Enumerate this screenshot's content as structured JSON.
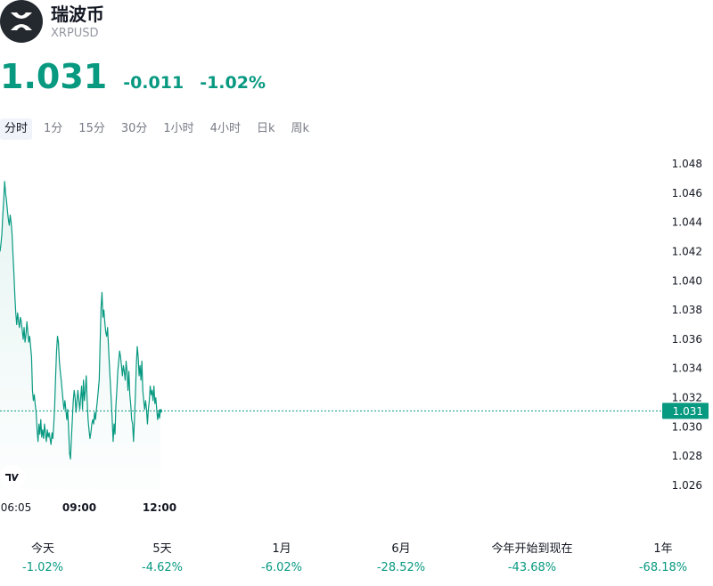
{
  "header": {
    "title": "瑞波币",
    "symbol": "XRPUSD"
  },
  "quote": {
    "price": "1.031",
    "change": "-0.011",
    "change_pct": "-1.02%",
    "color": "#089981"
  },
  "tabs": [
    {
      "label": "分时",
      "active": true
    },
    {
      "label": "1分"
    },
    {
      "label": "15分"
    },
    {
      "label": "30分"
    },
    {
      "label": "1小时"
    },
    {
      "label": "4小时"
    },
    {
      "label": "日k"
    },
    {
      "label": "周k"
    }
  ],
  "chart_data": {
    "type": "area",
    "y_ticks": [
      "1.048",
      "1.046",
      "1.044",
      "1.042",
      "1.040",
      "1.038",
      "1.036",
      "1.034",
      "1.032",
      "1.030",
      "1.028",
      "1.026"
    ],
    "ylim": [
      1.026,
      1.048
    ],
    "x_ticks": [
      {
        "label": "06:05",
        "bold": false
      },
      {
        "label": "09:00",
        "bold": true
      },
      {
        "label": "12:00",
        "bold": true
      }
    ],
    "current_price_label": "1.031",
    "current_price": 1.0311,
    "line_color": "#089981",
    "values": [
      1.042,
      1.0425,
      1.0432,
      1.0445,
      1.0455,
      1.0468,
      1.046,
      1.0455,
      1.0448,
      1.0442,
      1.0438,
      1.0445,
      1.044,
      1.0432,
      1.0418,
      1.0405,
      1.039,
      1.0378,
      1.037,
      1.0378,
      1.0372,
      1.0368,
      1.0375,
      1.0372,
      1.0366,
      1.036,
      1.0368,
      1.0358,
      1.0363,
      1.0372,
      1.0365,
      1.0358,
      1.0362,
      1.0355,
      1.0348,
      1.0325,
      1.0318,
      1.0322,
      1.0315,
      1.031,
      1.0298,
      1.029,
      1.0302,
      1.0295,
      1.0305,
      1.0293,
      1.0298,
      1.0292,
      1.0302,
      1.0296,
      1.029,
      1.0298,
      1.0293,
      1.0296,
      1.0292,
      1.0288,
      1.0296,
      1.0292,
      1.0302,
      1.0315,
      1.0335,
      1.0352,
      1.0362,
      1.0358,
      1.0345,
      1.0338,
      1.0332,
      1.0325,
      1.0318,
      1.0312,
      1.0318,
      1.0312,
      1.0305,
      1.0312,
      1.0298,
      1.0282,
      1.0278,
      1.0292,
      1.0305,
      1.0318,
      1.0325,
      1.032,
      1.031,
      1.0318,
      1.0325,
      1.0318,
      1.0312,
      1.032,
      1.0328,
      1.0312,
      1.0332,
      1.0318,
      1.0325,
      1.0335,
      1.0318,
      1.0305,
      1.0298,
      1.0292,
      1.0296,
      1.0302,
      1.0305,
      1.0302,
      1.031,
      1.0305,
      1.0312,
      1.0318,
      1.0325,
      1.0332,
      1.0358,
      1.0382,
      1.0392,
      1.0375,
      1.038,
      1.0372,
      1.0365,
      1.0362,
      1.0368,
      1.0355,
      1.0342,
      1.033,
      1.0318,
      1.0305,
      1.029,
      1.0302,
      1.0295,
      1.0315,
      1.0325,
      1.0338,
      1.0345,
      1.0352,
      1.0348,
      1.0342,
      1.0335,
      1.0342,
      1.0338,
      1.0332,
      1.0345,
      1.0338,
      1.0325,
      1.0338,
      1.0322,
      1.0315,
      1.0305,
      1.0302,
      1.029,
      1.0305,
      1.0322,
      1.0342,
      1.0355,
      1.0348,
      1.0335,
      1.0342,
      1.0332,
      1.0345,
      1.0325,
      1.0318,
      1.0312,
      1.0318,
      1.0312,
      1.0302,
      1.0312,
      1.0318,
      1.0328,
      1.0322,
      1.0325,
      1.0318,
      1.0328,
      1.0316,
      1.032,
      1.0312,
      1.0305,
      1.031,
      1.0306,
      1.0311
    ]
  },
  "periods": [
    {
      "label": "今天",
      "value": "-1.02%"
    },
    {
      "label": "5天",
      "value": "-4.62%"
    },
    {
      "label": "1月",
      "value": "-6.02%"
    },
    {
      "label": "6月",
      "value": "-28.52%"
    },
    {
      "label": "今年开始到现在",
      "value": "-43.68%"
    },
    {
      "label": "1年",
      "value": "-68.18%"
    }
  ]
}
